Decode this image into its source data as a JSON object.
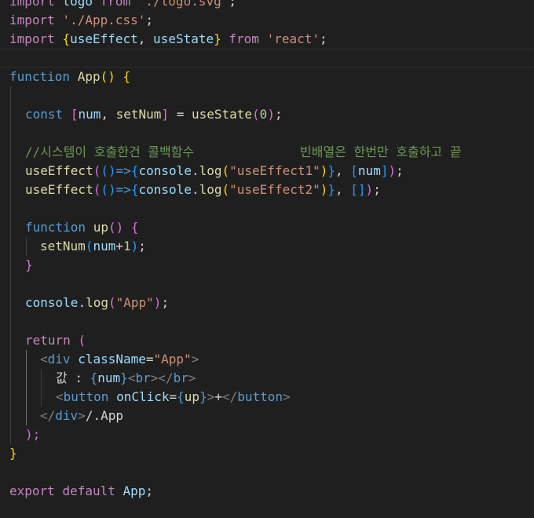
{
  "editor": {
    "lines": {
      "l1": {
        "a": "import",
        "b": " logo ",
        "c": "from",
        "d": " ",
        "e": "'./logo.svg'",
        "f": ";"
      },
      "l2": {
        "a": "import",
        "b": " ",
        "c": "'./App.css'",
        "d": ";"
      },
      "l3": {
        "a": "import",
        "b": " ",
        "c": "{",
        "d": "useEffect",
        "e": ", ",
        "f": "useState",
        "g": "}",
        "h": " ",
        "i": "from",
        "j": " ",
        "k": "'react'",
        "l": ";"
      },
      "l5": {
        "a": "function",
        "b": " ",
        "c": "App",
        "d": "()",
        "e": " ",
        "f": "{"
      },
      "l7": {
        "a": "const",
        "b": " ",
        "c": "[",
        "d": "num",
        "e": ", ",
        "f": "setNum",
        "g": "]",
        "h": " = ",
        "i": "useState",
        "j": "(",
        "k": "0",
        "l": ")",
        "m": ";"
      },
      "l9": {
        "a": "//시스템이 호출한건 콜백함수              빈배열은 한번만 호출하고 끝"
      },
      "l10": {
        "a": "useEffect",
        "b": "(",
        "c": "()",
        "d": "=>",
        "e": "{",
        "f": "console",
        "g": ".",
        "h": "log",
        "i": "(",
        "j": "\"useEffect1\"",
        "k": ")",
        "l": "}",
        "m": ", ",
        "n": "[",
        "o": "num",
        "p": "]",
        "q": ")",
        "r": ";"
      },
      "l11": {
        "a": "useEffect",
        "b": "(",
        "c": "()",
        "d": "=>",
        "e": "{",
        "f": "console",
        "g": ".",
        "h": "log",
        "i": "(",
        "j": "\"useEffect2\"",
        "k": ")",
        "l": "}",
        "m": ", ",
        "n": "[]",
        "o": ")",
        "p": ";"
      },
      "l13": {
        "a": "function",
        "b": " ",
        "c": "up",
        "d": "()",
        "e": " ",
        "f": "{"
      },
      "l14": {
        "a": "setNum",
        "b": "(",
        "c": "num",
        "d": "+",
        "e": "1",
        "f": ")",
        "g": ";"
      },
      "l15": {
        "a": "}"
      },
      "l17": {
        "a": "console",
        "b": ".",
        "c": "log",
        "d": "(",
        "e": "\"App\"",
        "f": ")",
        "g": ";"
      },
      "l19": {
        "a": "return",
        "b": " ",
        "c": "("
      },
      "l20": {
        "a": "<",
        "b": "div",
        "c": " ",
        "d": "className",
        "e": "=",
        "f": "\"App\"",
        "g": ">"
      },
      "l21": {
        "a": "값 : ",
        "b": "{",
        "c": "num",
        "d": "}",
        "e": "<",
        "f": "br",
        "g": "></",
        "h": "br",
        "i": ">"
      },
      "l22": {
        "a": "<",
        "b": "button",
        "c": " ",
        "d": "onClick",
        "e": "=",
        "f": "{",
        "g": "up",
        "h": "}",
        "i": ">",
        "j": "+",
        "k": "</",
        "l": "button",
        "m": ">"
      },
      "l23": {
        "a": "</",
        "b": "div",
        "c": ">",
        "d": "/.App"
      },
      "l24": {
        "a": ");"
      },
      "l25": {
        "a": "}"
      },
      "l27": {
        "a": "export",
        "b": " ",
        "c": "default",
        "d": " ",
        "e": "App",
        "f": ";"
      }
    }
  }
}
